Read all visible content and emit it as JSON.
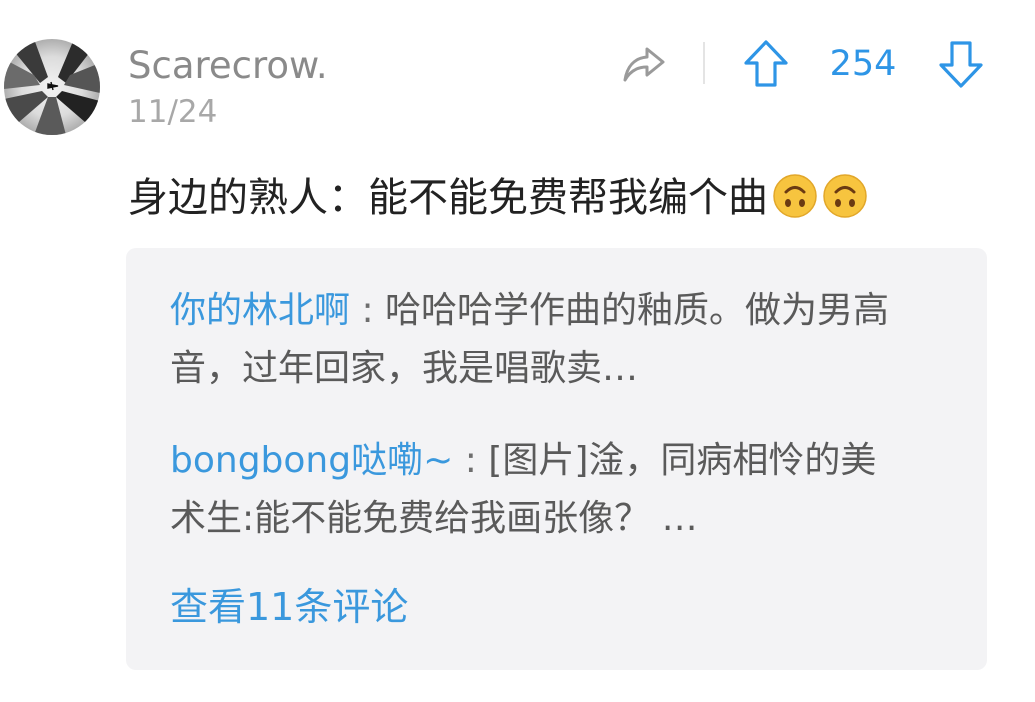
{
  "post": {
    "username": "Scarecrow.",
    "date": "11/24",
    "vote_count": "254",
    "text": "身边的熟人：能不能免费帮我编个曲",
    "emojis": [
      "upside-down-face-emoji",
      "upside-down-face-emoji"
    ]
  },
  "icons": {
    "share": "share-arrow-icon",
    "upvote": "arrow-up-icon",
    "downvote": "arrow-down-icon"
  },
  "colors": {
    "accent": "#2e95e6",
    "link": "#3a98dd",
    "comment_bg": "#f3f3f5"
  },
  "comments": [
    {
      "author": "你的林北啊",
      "separator": " : ",
      "text": "哈哈哈学作曲的釉质。做为男高音，过年回家，我是唱歌卖…"
    },
    {
      "author": "bongbong哒嘞~",
      "separator": " : ",
      "text": "[图片]淦，同病相怜的美术生:能不能免费给我画张像？ …"
    }
  ],
  "more_comments_label": "查看11条评论"
}
